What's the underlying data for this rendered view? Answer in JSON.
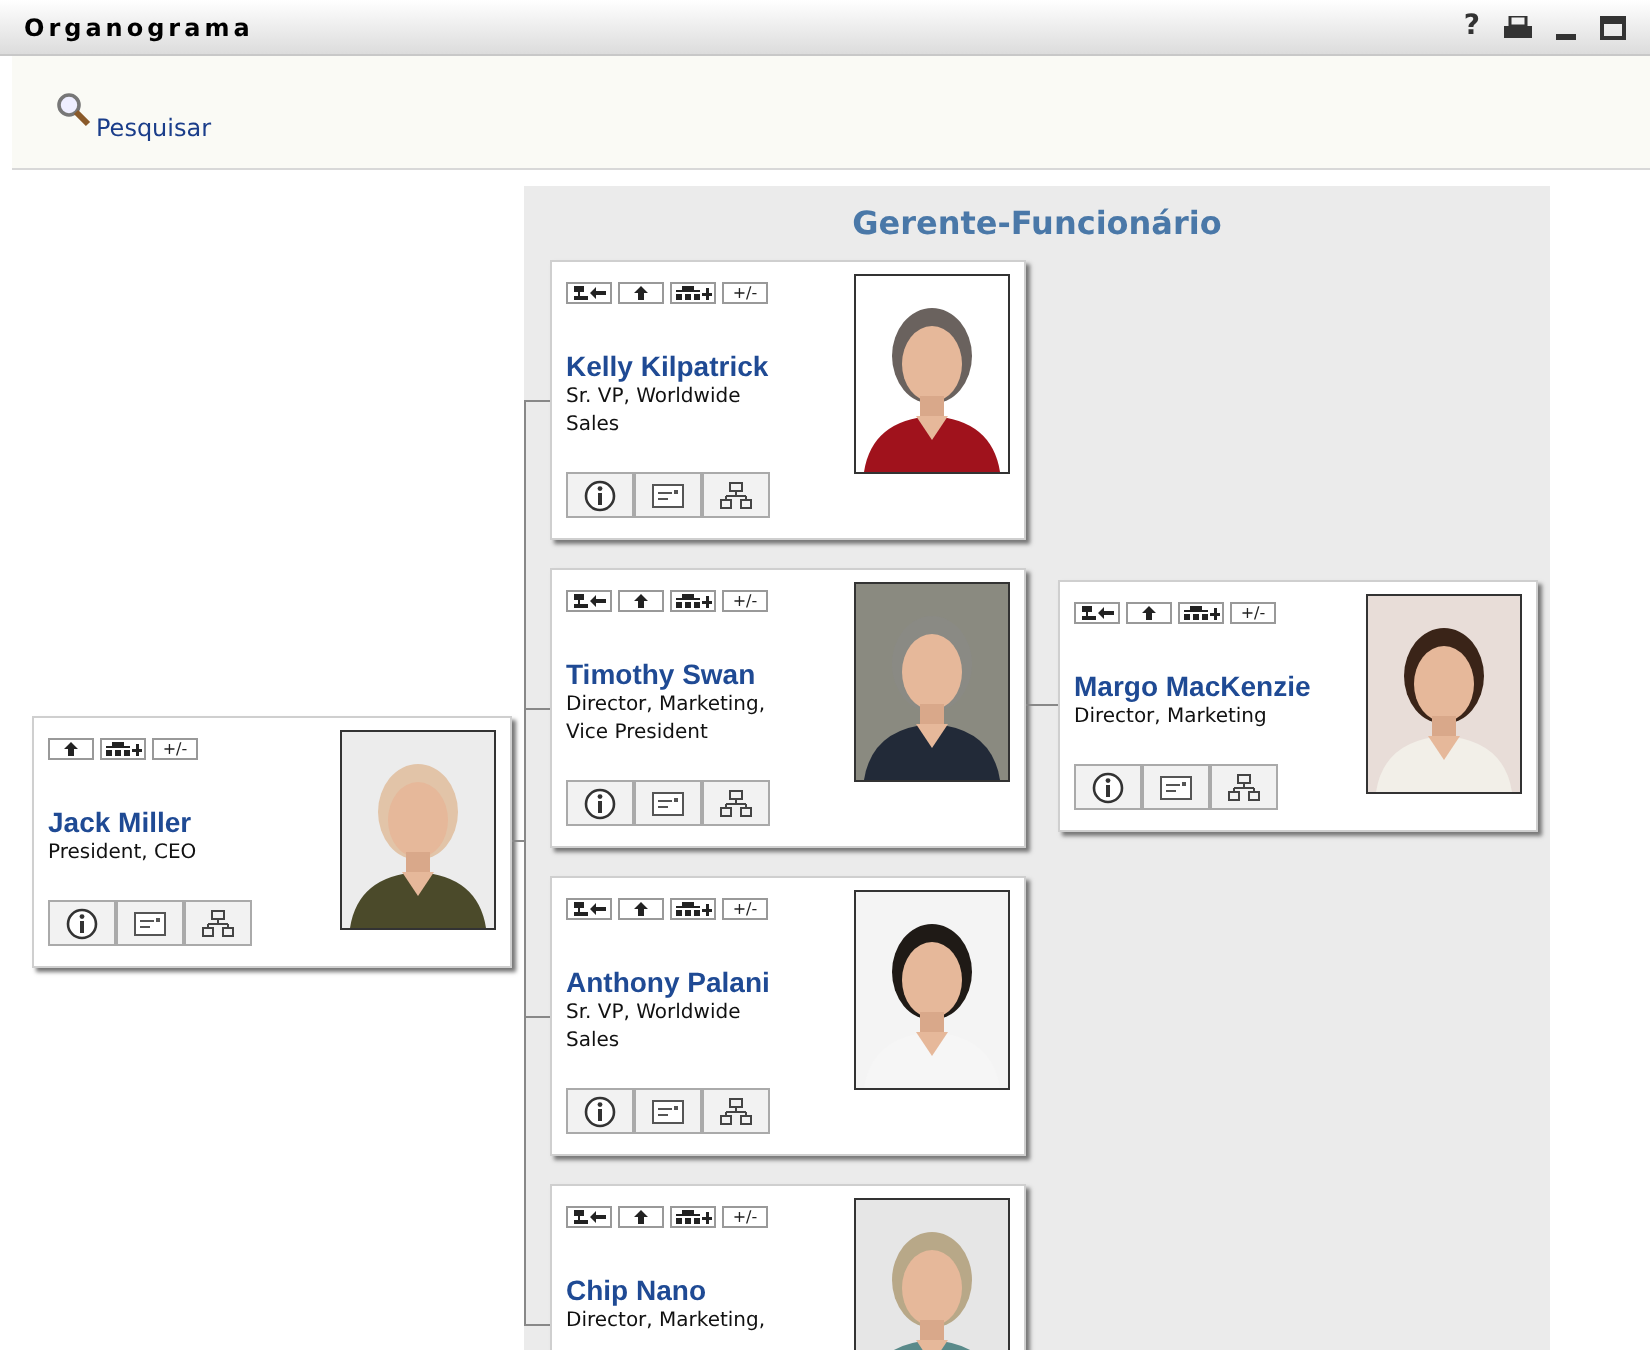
{
  "window": {
    "title": "Organograma",
    "help": "?"
  },
  "toolbar": {
    "search_link": "Pesquisar"
  },
  "panel": {
    "heading": "Gerente-Funcionário"
  },
  "root": {
    "name": "Jack Miller",
    "title": "President, CEO",
    "nav": [
      {
        "kind": "up"
      },
      {
        "kind": "reports"
      },
      {
        "kind": "toggle",
        "label": "+/-"
      }
    ],
    "actions": [
      {
        "kind": "info"
      },
      {
        "kind": "email"
      },
      {
        "kind": "org_chart"
      }
    ],
    "children": [
      {
        "name": "Kelly Kilpatrick",
        "title": "Sr. VP, Worldwide Sales",
        "nav": [
          {
            "kind": "manager"
          },
          {
            "kind": "up"
          },
          {
            "kind": "reports"
          },
          {
            "kind": "toggle",
            "label": "+/-"
          }
        ],
        "actions": [
          {
            "kind": "info"
          },
          {
            "kind": "email"
          },
          {
            "kind": "org_chart"
          }
        ]
      },
      {
        "name": "Timothy Swan",
        "title": "Director, Marketing, Vice President",
        "nav": [
          {
            "kind": "manager"
          },
          {
            "kind": "up"
          },
          {
            "kind": "reports"
          },
          {
            "kind": "toggle",
            "label": "+/-"
          }
        ],
        "actions": [
          {
            "kind": "info"
          },
          {
            "kind": "email"
          },
          {
            "kind": "org_chart"
          }
        ],
        "children": [
          {
            "name": "Margo MacKenzie",
            "title": "Director, Marketing",
            "nav": [
              {
                "kind": "manager"
              },
              {
                "kind": "up"
              },
              {
                "kind": "reports"
              },
              {
                "kind": "toggle",
                "label": "+/-"
              }
            ],
            "actions": [
              {
                "kind": "info"
              },
              {
                "kind": "email"
              },
              {
                "kind": "org_chart"
              }
            ]
          }
        ]
      },
      {
        "name": "Anthony Palani",
        "title": "Sr. VP, Worldwide Sales",
        "nav": [
          {
            "kind": "manager"
          },
          {
            "kind": "up"
          },
          {
            "kind": "reports"
          },
          {
            "kind": "toggle",
            "label": "+/-"
          }
        ],
        "actions": [
          {
            "kind": "info"
          },
          {
            "kind": "email"
          },
          {
            "kind": "org_chart"
          }
        ]
      },
      {
        "name": "Chip Nano",
        "title": "Director, Marketing,",
        "nav": [
          {
            "kind": "manager"
          },
          {
            "kind": "up"
          },
          {
            "kind": "reports"
          },
          {
            "kind": "toggle",
            "label": "+/-"
          }
        ]
      }
    ]
  }
}
